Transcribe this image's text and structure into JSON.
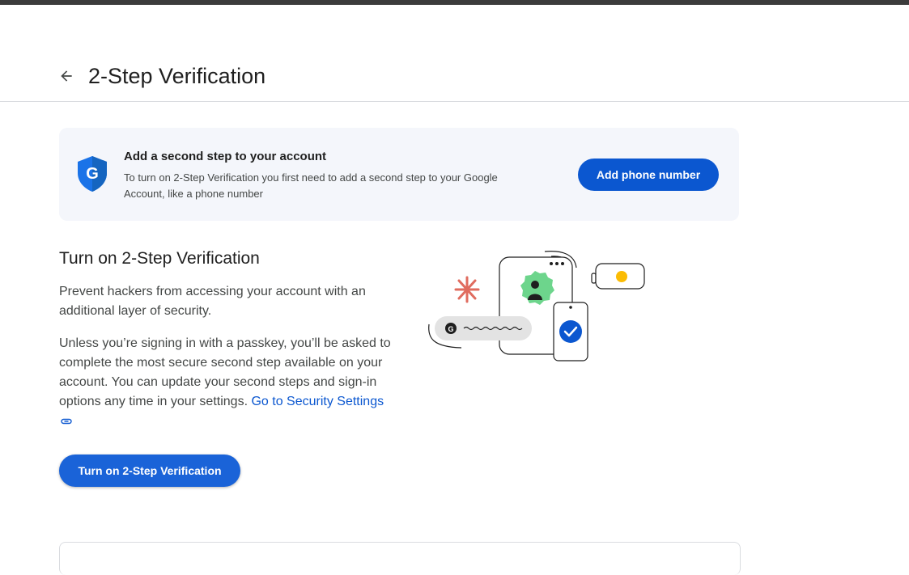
{
  "header": {
    "title": "2-Step Verification",
    "back_icon": "arrow-back-icon"
  },
  "banner": {
    "icon": "google-shield-icon",
    "title": "Add a second step to your account",
    "description": "To turn on 2-Step Verification you first need to add a second step to your Google Account, like a phone number",
    "button_label": "Add phone number"
  },
  "main": {
    "section_title": "Turn on 2-Step Verification",
    "paragraph1": "Prevent hackers from accessing your account with an additional layer of security.",
    "paragraph2": "Unless you’re signing in with a passkey, you’ll be asked to complete the most secure second step available on your account. You can update your second steps and sign-in options any time in your settings.",
    "security_link": "Go to Security Settings",
    "link_icon": "link-icon",
    "turn_on_button": "Turn on 2-Step Verification"
  },
  "colors": {
    "accent": "#0b57d0",
    "banner_bg": "#f4f6fb",
    "illustration_green": "#6dd58c",
    "illustration_red": "#e06c5f",
    "illustration_yellow": "#fbbc04"
  }
}
